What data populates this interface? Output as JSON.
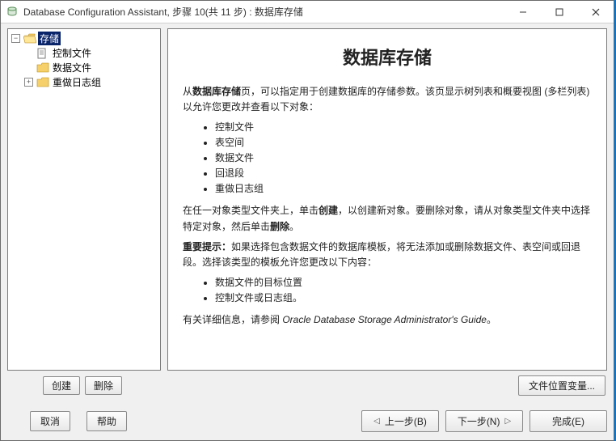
{
  "window": {
    "title": "Database Configuration Assistant, 步骤 10(共 11 步) : 数据库存储"
  },
  "tree": {
    "root": {
      "label": "存储",
      "selected": true
    },
    "children": [
      {
        "label": "控制文件",
        "iconType": "doc"
      },
      {
        "label": "数据文件",
        "iconType": "folder"
      },
      {
        "label": "重做日志组",
        "iconType": "folder",
        "expandable": true
      }
    ]
  },
  "content": {
    "heading": "数据库存储",
    "intro_prefix": "从",
    "intro_bold": "数据库存储",
    "intro_suffix": "页，可以指定用于创建数据库的存储参数。该页显示树列表和概要视图 (多栏列表) 以允许您更改并查看以下对象：",
    "list1": [
      "控制文件",
      "表空间",
      "数据文件",
      "回退段",
      "重做日志组"
    ],
    "para2_a": "在任一对象类型文件夹上，单击",
    "para2_b": "创建",
    "para2_c": "，以创建新对象。要删除对象，请从对象类型文件夹中选择特定对象，然后单击",
    "para2_d": "删除",
    "para2_e": "。",
    "important_label": "重要提示：",
    "important_text": "如果选择包含数据文件的数据库模板，将无法添加或删除数据文件、表空间或回退段。选择该类型的模板允许您更改以下内容：",
    "list2": [
      "数据文件的目标位置",
      "控制文件或日志组。"
    ],
    "footnote_a": "有关详细信息，请参阅 ",
    "footnote_italic": "Oracle Database Storage Administrator's Guide",
    "footnote_b": "。"
  },
  "buttons": {
    "create": "创建",
    "delete": "删除",
    "file_loc": "文件位置变量...",
    "cancel": "取消",
    "help": "帮助",
    "back": "上一步(B)",
    "next": "下一步(N)",
    "finish": "完成(E)"
  }
}
